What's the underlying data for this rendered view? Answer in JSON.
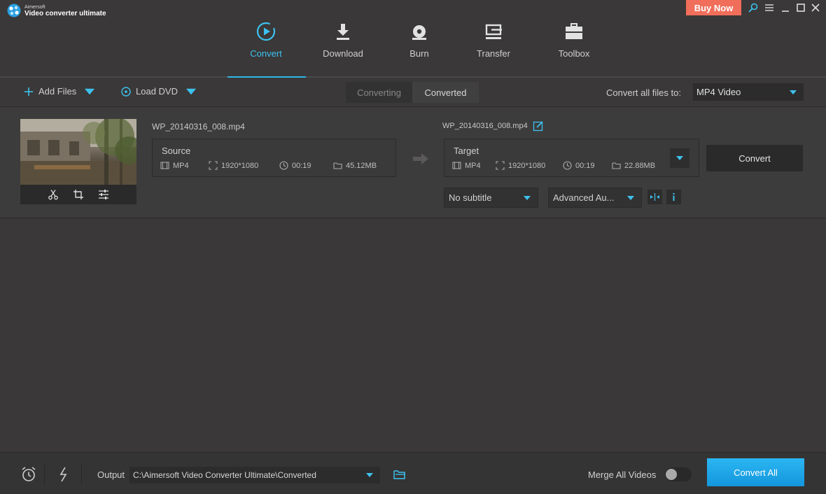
{
  "app": {
    "brand": "Aimersoft",
    "product": "Video converter ultimate",
    "buy_now": "Buy Now"
  },
  "nav": {
    "items": [
      {
        "label": "Convert",
        "icon": "convert-icon",
        "active": true
      },
      {
        "label": "Download",
        "icon": "download-icon"
      },
      {
        "label": "Burn",
        "icon": "burn-icon"
      },
      {
        "label": "Transfer",
        "icon": "transfer-icon"
      },
      {
        "label": "Toolbox",
        "icon": "toolbox-icon"
      }
    ]
  },
  "toolbar": {
    "add_files": "Add Files",
    "load_dvd": "Load DVD",
    "tabs": [
      "Converting",
      "Converted"
    ],
    "active_tab": "Converted",
    "convert_all_label": "Convert all files to:",
    "format": "MP4 Video"
  },
  "file": {
    "source_name": "WP_20140316_008.mp4",
    "target_name": "WP_20140316_008.mp4",
    "source": {
      "title": "Source",
      "format": "MP4",
      "resolution": "1920*1080",
      "duration": "00:19",
      "size": "45.12MB"
    },
    "target": {
      "title": "Target",
      "format": "MP4",
      "resolution": "1920*1080",
      "duration": "00:19",
      "size": "22.88MB"
    },
    "convert_button": "Convert",
    "subtitle": "No subtitle",
    "audio": "Advanced Au..."
  },
  "bottom": {
    "output_label": "Output",
    "output_path": "C:\\Aimersoft Video Converter Ultimate\\Converted",
    "merge_label": "Merge All Videos",
    "merge_enabled": false,
    "convert_all": "Convert All"
  },
  "colors": {
    "accent": "#2eb7e6",
    "buy_now": "#f06e5a",
    "convert_all": "#1aa3e6"
  }
}
